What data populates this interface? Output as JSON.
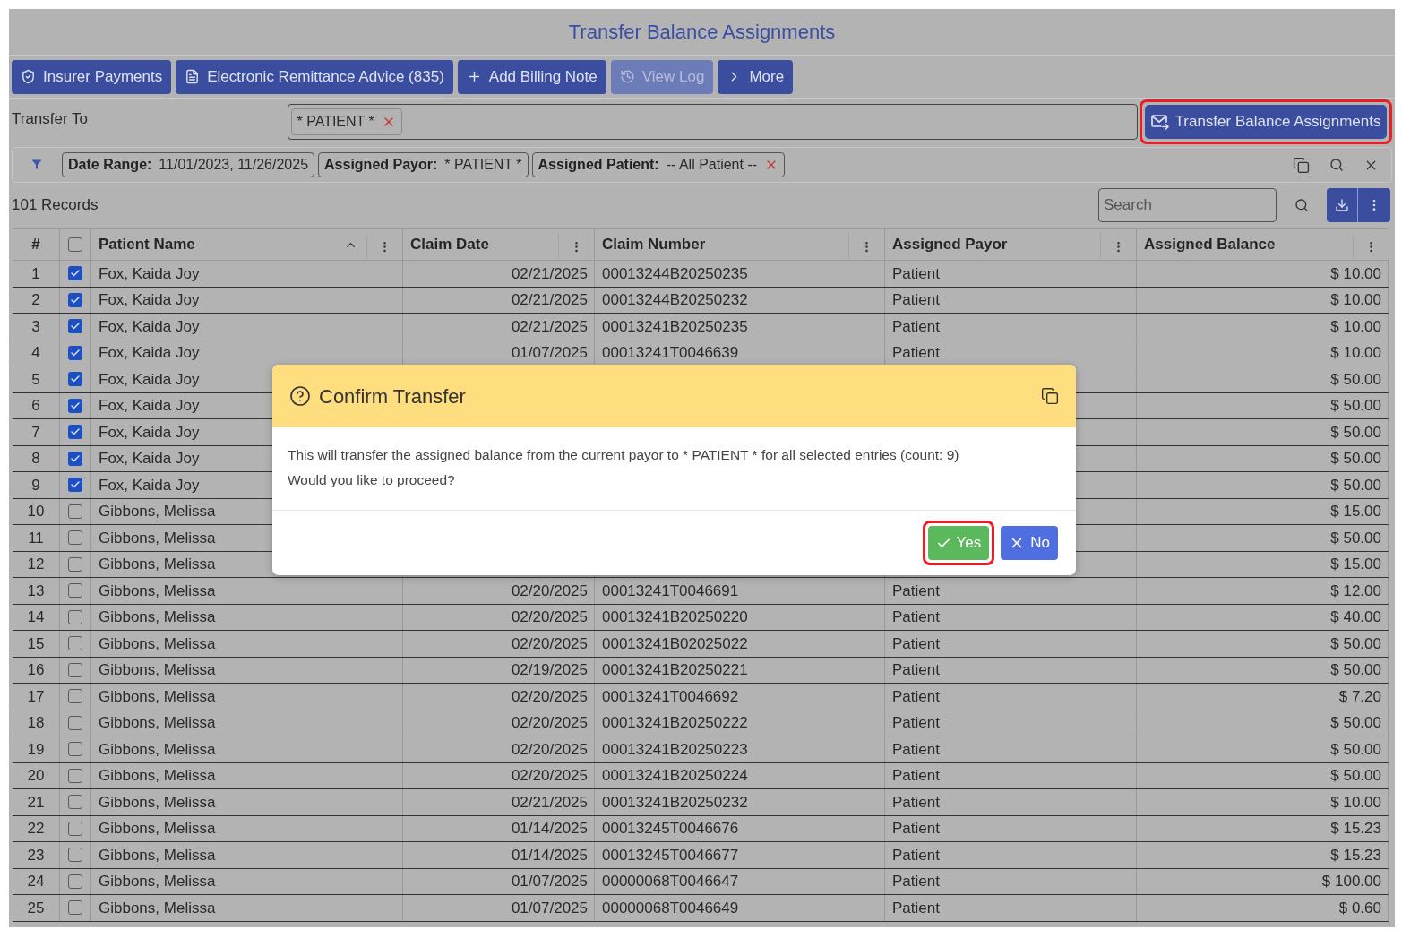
{
  "page": {
    "title": "Transfer Balance Assignments"
  },
  "toolbar": {
    "buttons": [
      {
        "label": "Insurer Payments",
        "kind": "payments",
        "disabled": false
      },
      {
        "label": "Electronic Remittance Advice (835)",
        "kind": "remittance",
        "disabled": false
      },
      {
        "label": "Add Billing Note",
        "kind": "add",
        "disabled": false
      },
      {
        "label": "View Log",
        "kind": "log",
        "disabled": true
      },
      {
        "label": "More",
        "kind": "more",
        "disabled": false
      }
    ]
  },
  "transfer_to": {
    "label": "Transfer To",
    "tags": [
      {
        "label": "* PATIENT *",
        "removable": true
      }
    ]
  },
  "transfer_button": {
    "label": "Transfer Balance Assignments",
    "highlighted": true
  },
  "filters": {
    "chips": [
      {
        "label": "Date Range:",
        "value": "11/01/2023, 11/26/2025",
        "removable": false
      },
      {
        "label": "Assigned Payor:",
        "value": "* PATIENT *",
        "removable": false
      },
      {
        "label": "Assigned Patient:",
        "value": "-- All Patient --",
        "removable": true
      }
    ]
  },
  "records": {
    "count_label": "101 Records",
    "search": {
      "placeholder": "Search"
    }
  },
  "table": {
    "select_all_checked": false,
    "columns": [
      {
        "label": "#",
        "kind": "number",
        "sort_ascending": false,
        "menu": false
      },
      {
        "kind": "select",
        "sort_ascending": false,
        "menu": false
      },
      {
        "label": "Patient Name",
        "kind": "text",
        "sort_ascending": true,
        "menu": true
      },
      {
        "label": "Claim Date",
        "kind": "text",
        "sort_ascending": false,
        "menu": true
      },
      {
        "label": "Claim Number",
        "kind": "text",
        "sort_ascending": false,
        "menu": true
      },
      {
        "label": "Assigned Payor",
        "kind": "text",
        "sort_ascending": false,
        "menu": true
      },
      {
        "label": "Assigned Balance",
        "kind": "text",
        "sort_ascending": false,
        "menu": true
      }
    ],
    "rows": [
      {
        "number": "1",
        "checked": true,
        "patient_name": "Fox, Kaida Joy",
        "claim_date": "02/21/2025",
        "claim_number": "00013244B20250235",
        "assigned_payor": "Patient",
        "assigned_balance": "$ 10.00"
      },
      {
        "number": "2",
        "checked": true,
        "patient_name": "Fox, Kaida Joy",
        "claim_date": "02/21/2025",
        "claim_number": "00013244B20250232",
        "assigned_payor": "Patient",
        "assigned_balance": "$ 10.00"
      },
      {
        "number": "3",
        "checked": true,
        "patient_name": "Fox, Kaida Joy",
        "claim_date": "02/21/2025",
        "claim_number": "00013241B20250235",
        "assigned_payor": "Patient",
        "assigned_balance": "$ 10.00"
      },
      {
        "number": "4",
        "checked": true,
        "patient_name": "Fox, Kaida Joy",
        "claim_date": "01/07/2025",
        "claim_number": "00013241T0046639",
        "assigned_payor": "Patient",
        "assigned_balance": "$ 10.00"
      },
      {
        "number": "5",
        "checked": true,
        "patient_name": "Fox, Kaida Joy",
        "assigned_balance": "$ 50.00"
      },
      {
        "number": "6",
        "checked": true,
        "patient_name": "Fox, Kaida Joy",
        "assigned_balance": "$ 50.00"
      },
      {
        "number": "7",
        "checked": true,
        "patient_name": "Fox, Kaida Joy",
        "assigned_balance": "$ 50.00"
      },
      {
        "number": "8",
        "checked": true,
        "patient_name": "Fox, Kaida Joy",
        "assigned_balance": "$ 50.00"
      },
      {
        "number": "9",
        "checked": true,
        "patient_name": "Fox, Kaida Joy",
        "assigned_balance": "$ 50.00"
      },
      {
        "number": "10",
        "checked": false,
        "patient_name": "Gibbons, Melissa",
        "assigned_balance": "$ 15.00"
      },
      {
        "number": "11",
        "checked": false,
        "patient_name": "Gibbons, Melissa",
        "assigned_balance": "$ 50.00"
      },
      {
        "number": "12",
        "checked": false,
        "patient_name": "Gibbons, Melissa",
        "assigned_balance": "$ 15.00"
      },
      {
        "number": "13",
        "checked": false,
        "patient_name": "Gibbons, Melissa",
        "claim_date": "02/20/2025",
        "claim_number": "00013241T0046691",
        "assigned_payor": "Patient",
        "assigned_balance": "$ 12.00"
      },
      {
        "number": "14",
        "checked": false,
        "patient_name": "Gibbons, Melissa",
        "claim_date": "02/20/2025",
        "claim_number": "00013241B20250220",
        "assigned_payor": "Patient",
        "assigned_balance": "$ 40.00"
      },
      {
        "number": "15",
        "checked": false,
        "patient_name": "Gibbons, Melissa",
        "claim_date": "02/20/2025",
        "claim_number": "00013241B02025022",
        "assigned_payor": "Patient",
        "assigned_balance": "$ 50.00"
      },
      {
        "number": "16",
        "checked": false,
        "patient_name": "Gibbons, Melissa",
        "claim_date": "02/19/2025",
        "claim_number": "00013241B20250221",
        "assigned_payor": "Patient",
        "assigned_balance": "$ 50.00"
      },
      {
        "number": "17",
        "checked": false,
        "patient_name": "Gibbons, Melissa",
        "claim_date": "02/20/2025",
        "claim_number": "00013241T0046692",
        "assigned_payor": "Patient",
        "assigned_balance": "$ 7.20"
      },
      {
        "number": "18",
        "checked": false,
        "patient_name": "Gibbons, Melissa",
        "claim_date": "02/20/2025",
        "claim_number": "00013241B20250222",
        "assigned_payor": "Patient",
        "assigned_balance": "$ 50.00"
      },
      {
        "number": "19",
        "checked": false,
        "patient_name": "Gibbons, Melissa",
        "claim_date": "02/20/2025",
        "claim_number": "00013241B20250223",
        "assigned_payor": "Patient",
        "assigned_balance": "$ 50.00"
      },
      {
        "number": "20",
        "checked": false,
        "patient_name": "Gibbons, Melissa",
        "claim_date": "02/20/2025",
        "claim_number": "00013241B20250224",
        "assigned_payor": "Patient",
        "assigned_balance": "$ 50.00"
      },
      {
        "number": "21",
        "checked": false,
        "patient_name": "Gibbons, Melissa",
        "claim_date": "02/21/2025",
        "claim_number": "00013241B20250232",
        "assigned_payor": "Patient",
        "assigned_balance": "$ 10.00"
      },
      {
        "number": "22",
        "checked": false,
        "patient_name": "Gibbons, Melissa",
        "claim_date": "01/14/2025",
        "claim_number": "00013245T0046676",
        "assigned_payor": "Patient",
        "assigned_balance": "$ 15.23"
      },
      {
        "number": "23",
        "checked": false,
        "patient_name": "Gibbons, Melissa",
        "claim_date": "01/14/2025",
        "claim_number": "00013245T0046677",
        "assigned_payor": "Patient",
        "assigned_balance": "$ 15.23"
      },
      {
        "number": "24",
        "checked": false,
        "patient_name": "Gibbons, Melissa",
        "claim_date": "01/07/2025",
        "claim_number": "00000068T0046647",
        "assigned_payor": "Patient",
        "assigned_balance": "$ 100.00"
      },
      {
        "number": "25",
        "checked": false,
        "patient_name": "Gibbons, Melissa",
        "claim_date": "01/07/2025",
        "claim_number": "00000068T0046649",
        "assigned_payor": "Patient",
        "assigned_balance": "$ 0.60"
      }
    ]
  },
  "dialog": {
    "title": "Confirm Transfer",
    "message": [
      "This will transfer the assigned balance from the current payor to * PATIENT * for all selected entries (count: 9)",
      "Would you like to proceed?"
    ],
    "buttons": [
      {
        "label": "Yes",
        "kind": "confirm",
        "highlighted": true
      },
      {
        "label": "No",
        "kind": "cancel",
        "highlighted": false
      }
    ]
  }
}
